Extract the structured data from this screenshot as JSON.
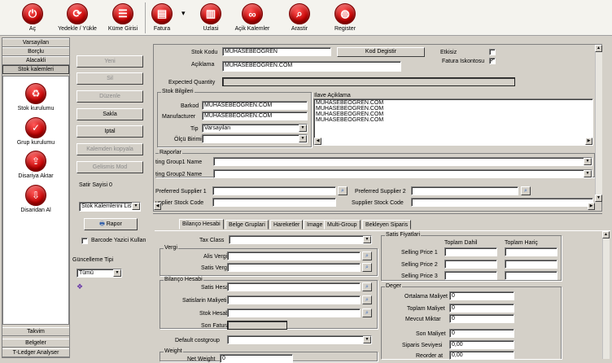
{
  "toolbar": {
    "items": [
      {
        "label": "Aç",
        "icon": "power-icon"
      },
      {
        "label": "Yedekle / Yükle",
        "icon": "folder-refresh-icon"
      },
      {
        "label": "Küme Girisi",
        "icon": "list-icon"
      },
      {
        "label": "Fatura",
        "icon": "document-icon"
      },
      {
        "label": "Uzlasi",
        "icon": "trash-icon"
      },
      {
        "label": "Açik Kalemler",
        "icon": "link-icon"
      },
      {
        "label": "Arastir",
        "icon": "search-icon"
      },
      {
        "label": "Register",
        "icon": "globe-icon"
      }
    ]
  },
  "sidebar": {
    "top_items": [
      "Varsayilan",
      "Borçlu",
      "Alacakli",
      "Stok kalemleri"
    ],
    "active": "Stok kalemleri",
    "tools": [
      {
        "label": "Stok kurulumu",
        "icon": "recycle-icon"
      },
      {
        "label": "Grup kurulumu",
        "icon": "check-document-icon"
      },
      {
        "label": "Disariya Aktar",
        "icon": "export-icon"
      },
      {
        "label": "Disaridan Al",
        "icon": "import-icon"
      }
    ],
    "bottom_items": [
      "Takvim",
      "Belgeler",
      "T-Ledger Analyser"
    ]
  },
  "actions": {
    "yeni": "Yeni",
    "sil": "Sil",
    "duzenle": "Düzenle",
    "sakla": "Sakla",
    "iptal": "Iptal",
    "kopyala": "Kalemden kopyala",
    "gelismis": "Gelismis Mod",
    "satir_sayisi": "Satir Sayisi 0",
    "liste_select": "Stok Kalemlerini Liste",
    "rapor": "Rapor",
    "barcode": "Barcode Yazici Kullan",
    "guncelleme_label": "Güncelleme Tipi",
    "guncelleme_value": "Tümü"
  },
  "form": {
    "stok_kodu_label": "Stok Kodu",
    "stok_kodu": "MUHASEBEOGREN",
    "kod_degistir": "Kod Degistir",
    "etkisiz": "Etkisiz",
    "fatura_iskontosu": "Fatura Iskontosu",
    "aciklama_label": "Açiklama",
    "aciklama": "MUHASEBEOGREN.COM",
    "expected_quantity": "Expected Quantity",
    "stok_bilgileri": "Stok Bilgileri",
    "barkod_label": "Barkod",
    "barkod": "MUHASEBEOGREN.COM",
    "manufacturer_label": "Manufacturer",
    "manufacturer": "MUHASEBEOGREN.COM",
    "tip_label": "Tip",
    "tip": "Varsayilan",
    "olcu_label": "Ölçü Birimi",
    "olcu": "",
    "ilave_label": "Ilave Açiklama",
    "ilave_lines": [
      "MUHASEBEOGREN.COM",
      "MUHASEBEOGREN.COM",
      "MUHASEBEOGREN.COM",
      "MUHASEBEOGREN.COM"
    ],
    "raporlar": "Raporlar",
    "rg1": "ting Group1 Name",
    "rg2": "ting Group2 Name",
    "ps1": "Preferred Supplier 1",
    "ps2": "Preferred Supplier 2",
    "ssc1": "upplier Stock Code",
    "ssc2": "Supplier Stock Code"
  },
  "tabs": [
    "Bilanço Hesabi",
    "Belge Gruplari",
    "Hareketler",
    "Image",
    "Multi-Group",
    "Bekleyen Siparis"
  ],
  "bilanco": {
    "tax_class": "Tax Class",
    "vergi": "Vergi",
    "alis_vergisi": "Alis Vergisi",
    "satis_vergisi": "Satis Vergisi",
    "bilanco_hesabi": "Bilanço Hesabi",
    "satis_hesabi": "Satis Hesabi",
    "satislarin_maliyeti": "Satislarin Maliyeti",
    "stok_hesabi": "Stok Hesabi",
    "son_fatura": "Son Fatura",
    "default_costgroup": "Default costgroup",
    "weight": "Weight",
    "net_weight": "Net Weight",
    "net_weight_value": "0"
  },
  "satis": {
    "title": "Satis Fiyatlari",
    "col1": "Toplam Dahil",
    "col2": "Toplam Hariç",
    "prices": [
      "Selling Price 1",
      "Selling Price 2",
      "Selling Price 3"
    ]
  },
  "deger": {
    "title": "Deger",
    "rows": [
      {
        "label": "Ortalama Maliyet",
        "value": "0"
      },
      {
        "label": "Toplam Maliyet",
        "value": "0"
      },
      {
        "label": "Mevcut Miktar",
        "value": "0"
      },
      {
        "label": "Son Maliyet",
        "value": "0"
      },
      {
        "label": "Siparis Seviyesi",
        "value": "0,00"
      },
      {
        "label": "Reorder at",
        "value": "0,00"
      }
    ]
  }
}
